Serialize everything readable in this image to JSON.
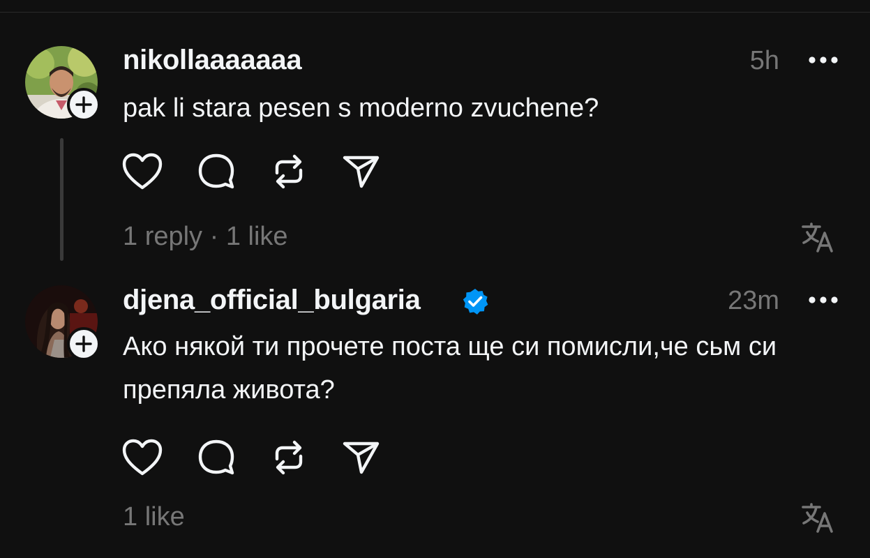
{
  "comments": [
    {
      "username": "nikollaaaaaaa",
      "verified": false,
      "timestamp": "5h",
      "text": "pak li stara pesen s moderno zvuchene?",
      "stats": "1 reply · 1 like"
    },
    {
      "username": "djena_official_bulgaria",
      "verified": true,
      "timestamp": "23m",
      "text": "Ако някой ти прочете поста ще си помисли,че сьм си препяла живота?",
      "stats": "1 like"
    }
  ],
  "icons": {
    "like": "heart-icon",
    "comment": "comment-icon",
    "repost": "repost-icon",
    "share": "send-icon",
    "more": "more-icon",
    "translate": "translate-icon",
    "follow": "plus-icon",
    "verified": "verified-badge-icon"
  },
  "colors": {
    "background": "#101010",
    "text": "#f3f5f7",
    "muted": "#777777",
    "verified": "#0095f6"
  }
}
